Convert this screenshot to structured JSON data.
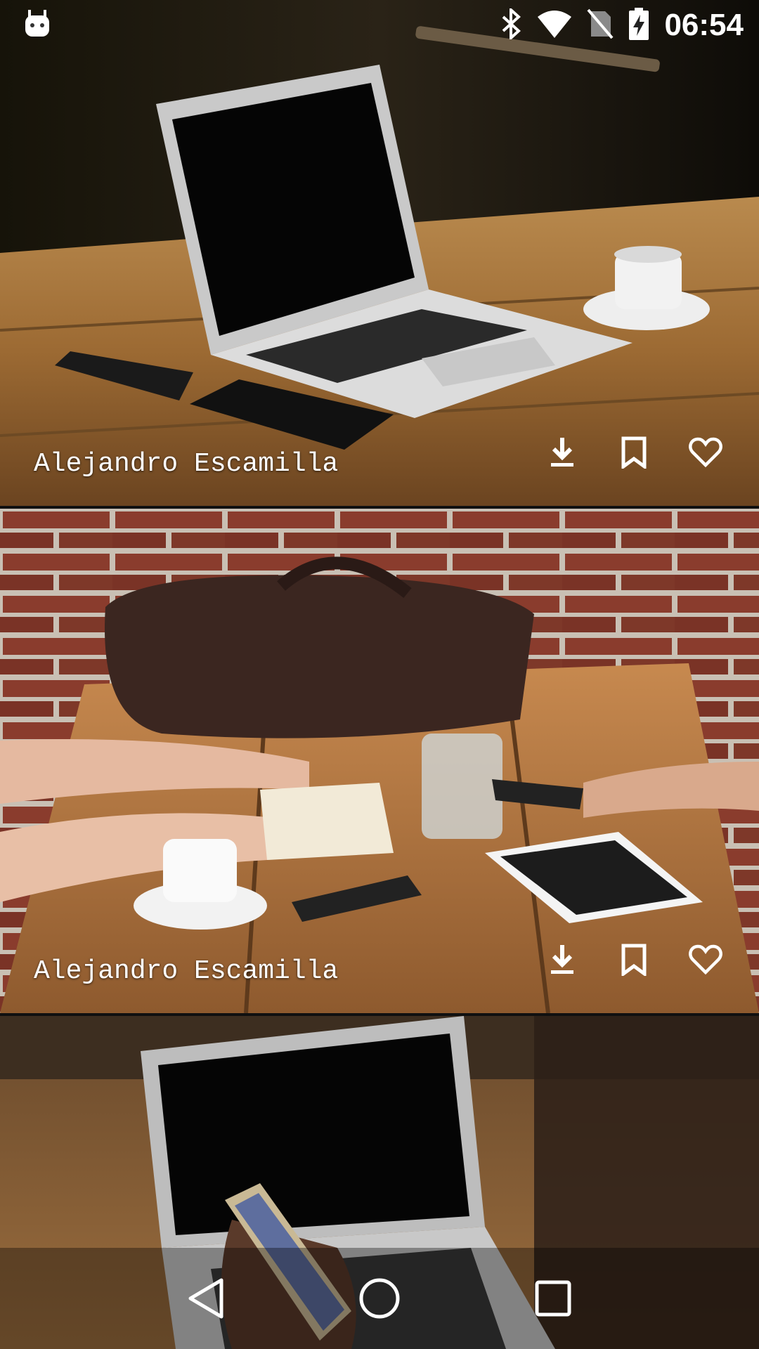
{
  "status_bar": {
    "time": "06:54",
    "icons": [
      "android-icon",
      "bluetooth-icon",
      "wifi-icon",
      "no-sim-icon",
      "battery-charging-icon"
    ]
  },
  "feed": {
    "cards": [
      {
        "author": "Alejandro Escamilla",
        "image": "laptop on wooden table with phone, notebook and coffee cup"
      },
      {
        "author": "Alejandro Escamilla",
        "image": "people at wooden table with leather bag, notebook, glass of water, tablet and phones"
      },
      {
        "author": "",
        "image": "hand holding phone in front of laptop"
      }
    ],
    "actions": [
      "download-icon",
      "bookmark-icon",
      "heart-icon"
    ]
  },
  "nav_bar": {
    "buttons": [
      "back-button",
      "home-button",
      "recents-button"
    ]
  },
  "colors": {
    "icon": "#ffffff",
    "wood": "#a9773e",
    "brick": "#7e3a2c"
  }
}
